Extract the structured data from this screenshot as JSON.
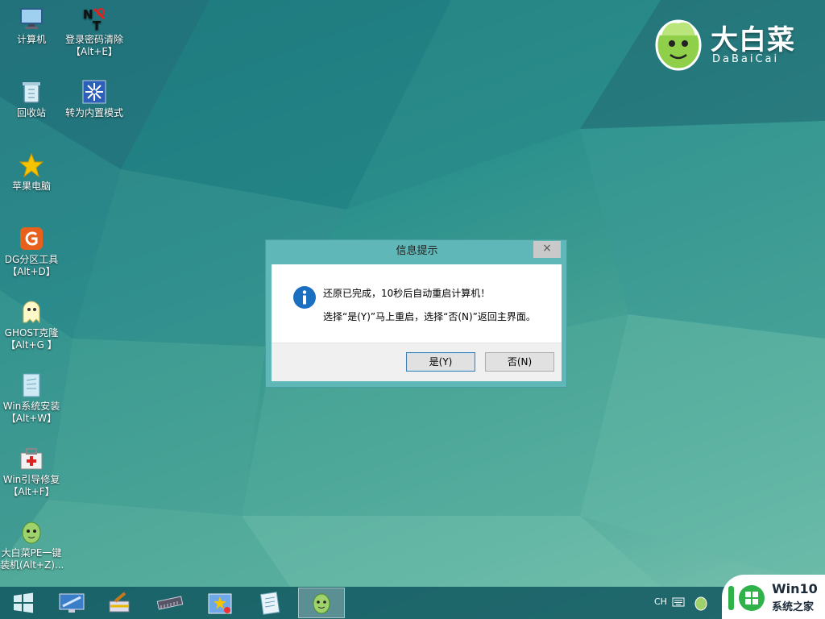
{
  "desktop": {
    "icons": [
      {
        "label": "计算机",
        "icon": "computer-icon"
      },
      {
        "label": "登录密码清除",
        "sub": "【Alt+E】",
        "icon": "password-clear-icon"
      },
      {
        "label": "回收站",
        "icon": "recycle-bin-icon"
      },
      {
        "label": "转为内置模式",
        "icon": "builtin-mode-icon"
      },
      {
        "label": "苹果电脑",
        "icon": "star-icon"
      },
      {
        "label": "DG分区工具",
        "sub": "【Alt+D】",
        "icon": "diskgenius-icon"
      },
      {
        "label": "GHOST克隆",
        "sub": "【Alt+G 】",
        "icon": "ghost-icon"
      },
      {
        "label": "Win系统安装",
        "sub": "【Alt+W】",
        "icon": "win-install-icon"
      },
      {
        "label": "Win引导修复",
        "sub": "【Alt+F】",
        "icon": "boot-repair-icon"
      },
      {
        "label": "大白菜PE一键",
        "sub": "装机(Alt+Z)...",
        "icon": "dabaicai-installer-icon"
      }
    ]
  },
  "brand": {
    "name_cn": "大白菜",
    "name_en": "DaBaiCai"
  },
  "dialog": {
    "title": "信息提示",
    "close_label": "×",
    "message_line1": "还原已完成，10秒后自动重启计算机！",
    "message_line2": "选择“是(Y)”马上重启，选择“否(N)”返回主界面。",
    "yes_label": "是(Y)",
    "no_label": "否(N)"
  },
  "taskbar": {
    "items": [
      "start-icon",
      "desktop-app-icon",
      "cleaner-icon",
      "memory-icon",
      "tools-icon",
      "notepad-icon",
      "dabaicai-icon"
    ],
    "tray_lang": "CH"
  },
  "watermark": {
    "title": "Win10",
    "subtitle": "系统之家"
  },
  "colors": {
    "accent": "#60b7b7",
    "taskbar": "#125860",
    "info_blue": "#1a6fc0"
  }
}
